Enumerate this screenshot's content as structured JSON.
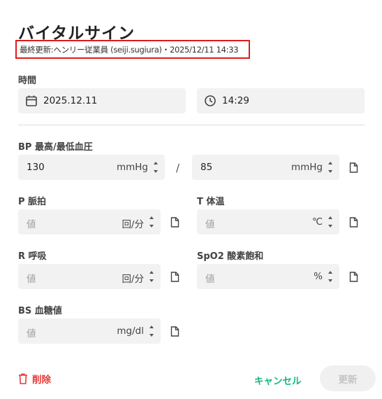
{
  "header": {
    "title": "バイタルサイン",
    "last_updated": "最終更新:ヘンリー従業員 (seiji.sugiura)・2025/12/11 14:33"
  },
  "time_section": {
    "label": "時間",
    "date_value": "2025.12.11",
    "time_value": "14:29"
  },
  "bp": {
    "label": "BP 最高/最低血圧",
    "systolic_value": "130",
    "diastolic_value": "85",
    "unit": "mmHg",
    "separator": "/"
  },
  "pulse": {
    "label": "P 脈拍",
    "placeholder": "値",
    "unit": "回/分"
  },
  "temperature": {
    "label": "T 体温",
    "placeholder": "値",
    "unit": "℃"
  },
  "respiration": {
    "label": "R 呼吸",
    "placeholder": "値",
    "unit": "回/分"
  },
  "spo2": {
    "label": "SpO2 酸素飽和",
    "placeholder": "値",
    "unit": "%"
  },
  "bs": {
    "label": "BS 血糖値",
    "placeholder": "値",
    "unit": "mg/dl"
  },
  "actions": {
    "delete_label": "削除",
    "cancel_label": "キャンセル",
    "update_label": "更新"
  },
  "colors": {
    "highlight_border": "#e01a1a",
    "delete": "#e53935",
    "cancel": "#10b981",
    "field_bg": "#f2f2f2",
    "disabled_text": "#c4c4c4"
  },
  "icons": [
    "calendar-icon",
    "clock-icon",
    "document-icon",
    "trash-icon",
    "spinner-arrows-icon"
  ]
}
